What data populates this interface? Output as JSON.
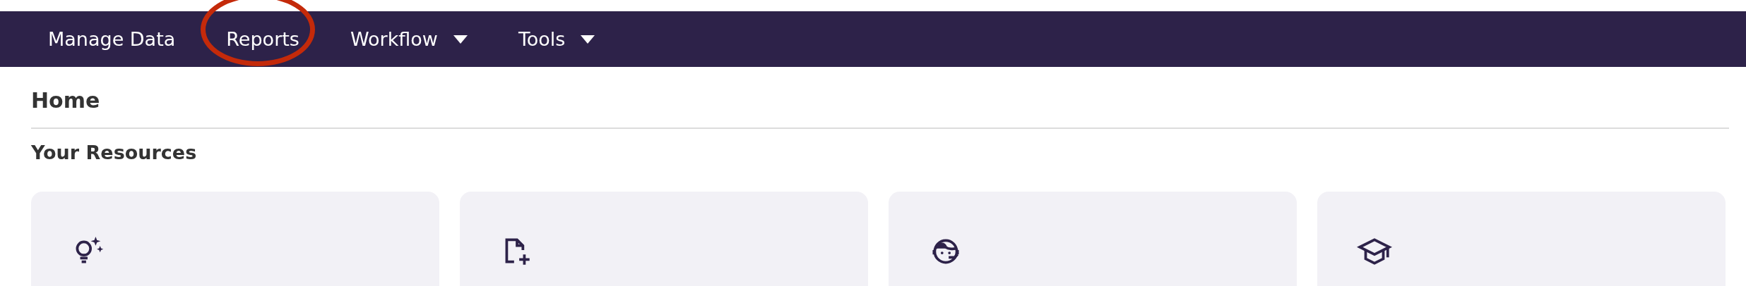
{
  "nav": {
    "items": [
      {
        "label": "Manage Data",
        "dropdown": false,
        "circled": false
      },
      {
        "label": "Reports",
        "dropdown": false,
        "circled": true
      },
      {
        "label": "Workflow",
        "dropdown": true,
        "circled": false
      },
      {
        "label": "Tools",
        "dropdown": true,
        "circled": false
      }
    ]
  },
  "page": {
    "title": "Home",
    "section": "Your Resources"
  },
  "resources": [
    {
      "kind": "idea"
    },
    {
      "kind": "new-document"
    },
    {
      "kind": "support"
    },
    {
      "kind": "learning"
    }
  ]
}
